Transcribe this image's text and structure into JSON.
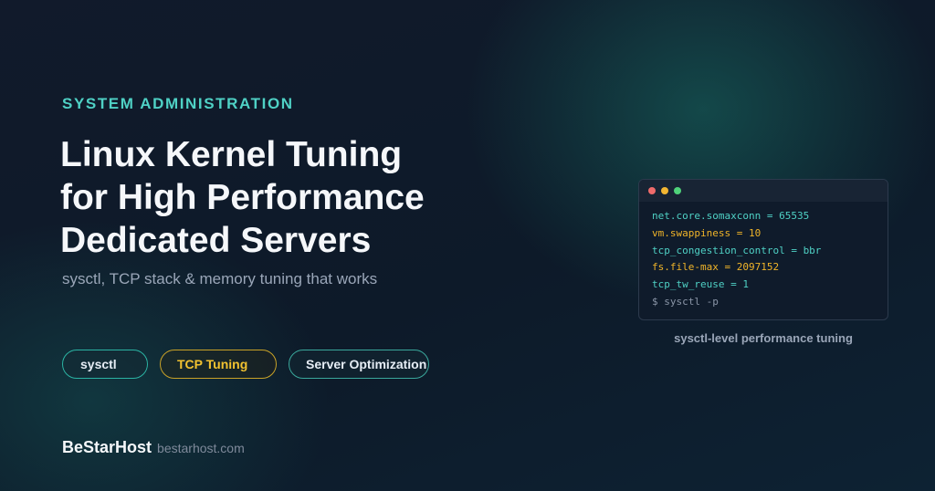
{
  "hero": {
    "eyebrow": "SYSTEM ADMINISTRATION",
    "title_lines": [
      "Linux Kernel Tuning",
      "for High Performance",
      "Dedicated Servers"
    ],
    "subtitle": "sysctl, TCP stack & memory tuning that works"
  },
  "tags": [
    {
      "label": "sysctl",
      "border_color": "#2bb3a3",
      "text_color": "#e6edf5"
    },
    {
      "label": "TCP Tuning",
      "border_color": "#c9a227",
      "text_color": "#f2c230"
    },
    {
      "label": "Server Optimization",
      "border_color": "#3aa89c",
      "text_color": "#e6edf5"
    }
  ],
  "brand": {
    "name": "BeStarHost",
    "url": "bestarhost.com"
  },
  "terminal": {
    "window_controls": [
      "close-dot",
      "minimize-dot",
      "maximize-dot"
    ],
    "lines": [
      {
        "text": "net.core.somaxconn = 65535",
        "color": "#4fd1c5"
      },
      {
        "text": "vm.swappiness = 10",
        "color": "#f0b429"
      },
      {
        "text": "tcp_congestion_control = bbr",
        "color": "#4fd1c5"
      },
      {
        "text": "fs.file-max = 2097152",
        "color": "#f0b429"
      },
      {
        "text": "tcp_tw_reuse = 1",
        "color": "#4fd1c5"
      },
      {
        "text": "$ sysctl -p",
        "color": "#8b96a8"
      }
    ],
    "caption": "sysctl-level performance tuning"
  },
  "colors": {
    "accent": "#4fd1c5",
    "highlight": "#f0b429",
    "background": "#0e1826"
  }
}
